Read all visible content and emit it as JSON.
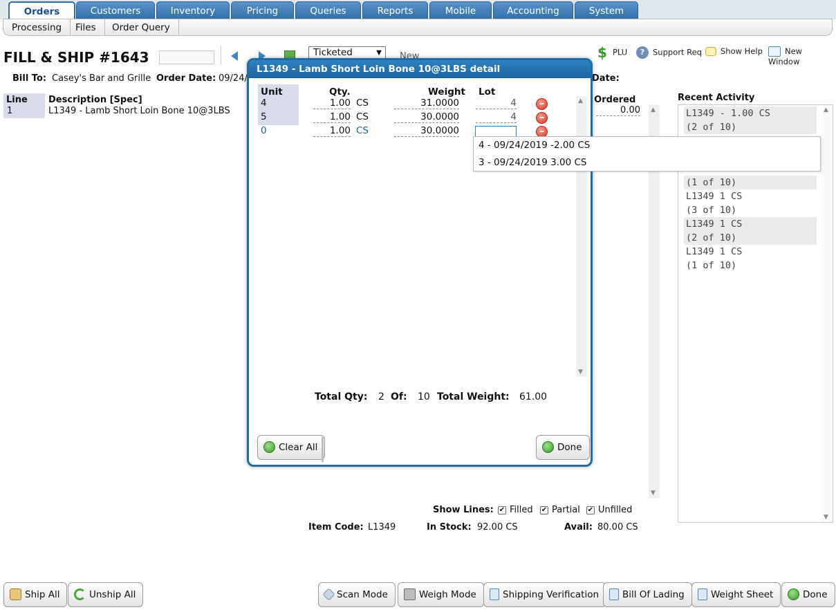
{
  "nav": {
    "tabs": [
      "Orders",
      "Customers",
      "Inventory",
      "Pricing",
      "Queries",
      "Reports",
      "Mobile",
      "Accounting",
      "System"
    ],
    "active_tab": "Orders",
    "subtabs": [
      "Processing",
      "Files",
      "Order Query"
    ]
  },
  "header": {
    "title": "FILL & SHIP #1643",
    "status_select": "Ticketed",
    "new_label": "New",
    "bill_to_label": "Bill To:",
    "bill_to_value": "Casey's Bar and Grille",
    "order_date_label": "Order Date:",
    "order_date_value": "09/24/",
    "right_date_label": "Date:"
  },
  "toolbar_right": {
    "plu": "PLU",
    "support": "Support Req",
    "help": "Show Help",
    "new_window": "New Window"
  },
  "lines_table": {
    "headers": [
      "Line",
      "Description [Spec]"
    ],
    "rows": [
      {
        "line": "1",
        "description": "L1349 - Lamb Short Loin Bone 10@3LBS"
      }
    ],
    "ordered_header": "k Ordered",
    "ordered_value": "0.00"
  },
  "activity": {
    "header": "Recent Activity",
    "items": [
      {
        "l1": "L1349 - 1.00 CS",
        "l2": "(2 of 10)"
      },
      {
        "l1": "",
        "l2": "(1 of 10)"
      },
      {
        "l1": "L1349 1 CS",
        "l2": "(3 of 10)"
      },
      {
        "l1": "L1349 1 CS",
        "l2": "(2 of 10)"
      },
      {
        "l1": "L1349 1 CS",
        "l2": "(1 of 10)"
      }
    ]
  },
  "modal": {
    "title": "L1349 - Lamb Short Loin Bone 10@3LBS detail",
    "headers": {
      "unit": "Unit",
      "qty": "Qty.",
      "weight": "Weight",
      "lot": "Lot"
    },
    "rows": [
      {
        "unit": "4",
        "qty": "1.00",
        "uom": "CS",
        "weight": "31.0000",
        "lot": "4"
      },
      {
        "unit": "5",
        "qty": "1.00",
        "uom": "CS",
        "weight": "30.0000",
        "lot": "4"
      },
      {
        "unit": "0",
        "qty": "1.00",
        "uom": "CS",
        "weight": "30.0000",
        "lot": ""
      }
    ],
    "totals": {
      "qty_label": "Total Qty:",
      "qty": "2",
      "of_label": "Of:",
      "of": "10",
      "weight_label": "Total Weight:",
      "weight": "61.00"
    },
    "clear_all": "Clear All",
    "done": "Done"
  },
  "lot_dropdown": {
    "options": [
      "4 - 09/24/2019 -2.00 CS",
      "3 - 09/24/2019 3.00 CS"
    ]
  },
  "show_lines": {
    "label": "Show Lines:",
    "filled": "Filled",
    "partial": "Partial",
    "unfilled": "Unfilled"
  },
  "item_info": {
    "code_label": "Item Code:",
    "code": "L1349",
    "stock_label": "In Stock:",
    "stock": "92.00 CS",
    "avail_label": "Avail:",
    "avail": "80.00 CS"
  },
  "bottom_buttons": {
    "ship_all": "Ship All",
    "unship_all": "Unship All",
    "scan_mode": "Scan Mode",
    "weigh_mode": "Weigh Mode",
    "shipping_verification": "Shipping Verification",
    "bill_of_lading": "Bill Of Lading",
    "weight_sheet": "Weight Sheet",
    "done": "Done"
  },
  "colors": {
    "accent": "#2f6fa8",
    "modal_border": "#1c6ea8",
    "link_blue": "#1a5fa0"
  }
}
